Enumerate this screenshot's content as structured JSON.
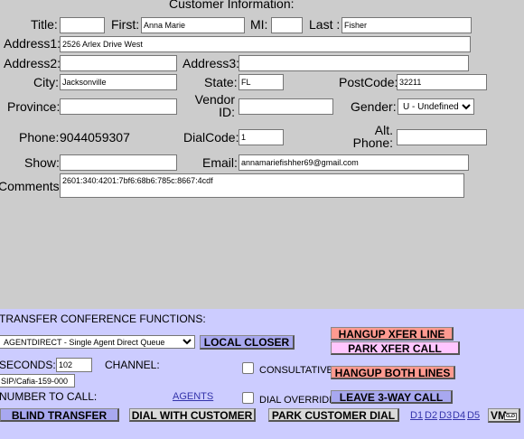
{
  "header": {
    "title": "Customer Information:"
  },
  "form": {
    "title_label": "Title:",
    "title_value": "",
    "first_label": "First:",
    "first_value": "Anna Marie",
    "mi_label": "MI:",
    "mi_value": "",
    "last_label": "Last :",
    "last_value": "Fisher",
    "address1_label": "Address1:",
    "address1_value": "2526 Arlex Drive West",
    "address2_label": "Address2:",
    "address2_value": "",
    "address3_label": "Address3:",
    "address3_value": "",
    "city_label": "City:",
    "city_value": "Jacksonville",
    "state_label": "State:",
    "state_value": "FL",
    "postcode_label": "PostCode:",
    "postcode_value": "32211",
    "province_label": "Province:",
    "province_value": "",
    "vendor_label_1": "Vendor",
    "vendor_label_2": "ID:",
    "vendor_value": "",
    "gender_label": "Gender:",
    "gender_value": "U - Undefined",
    "phone_label": "Phone:",
    "phone_value": "9044059307",
    "dialcode_label": "DialCode:",
    "dialcode_value": "1",
    "altphone_label_1": "Alt.",
    "altphone_label_2": "Phone:",
    "altphone_value": "",
    "show_label": "Show:",
    "show_value": "",
    "email_label": "Email:",
    "email_value": "annamariefishher69@gmail.com",
    "comments_label": "Comments:",
    "comments_value": "2601:340:4201:7bf6:68b6:785c:8667:4cdf"
  },
  "transfer": {
    "heading": "TRANSFER CONFERENCE FUNCTIONS:",
    "agent_select_value": "AGENTDIRECT - Single Agent Direct Queue",
    "local_closer": "LOCAL CLOSER",
    "hangup_xfer": "HANGUP XFER LINE",
    "park_xfer": "PARK XFER CALL",
    "seconds_label": "SECONDS:",
    "seconds_value": "102",
    "channel_label": "CHANNEL:",
    "consultative_label": "CONSULTATIVE",
    "hangup_both": "HANGUP BOTH LINES",
    "sip_value": "SIP/Cafia-159-000",
    "number_label": "NUMBER TO CALL:",
    "agents_link": "AGENTS",
    "dial_override_label": "DIAL OVERRIDE",
    "leave_3way": "LEAVE 3-WAY CALL",
    "blind_transfer": "BLIND TRANSFER",
    "dial_with_customer": "DIAL WITH CUSTOMER",
    "park_customer_dial": "PARK CUSTOMER DIAL",
    "d_links": [
      "D1",
      "D2",
      "D3",
      "D4",
      "D5"
    ],
    "vm_label": "VM"
  }
}
